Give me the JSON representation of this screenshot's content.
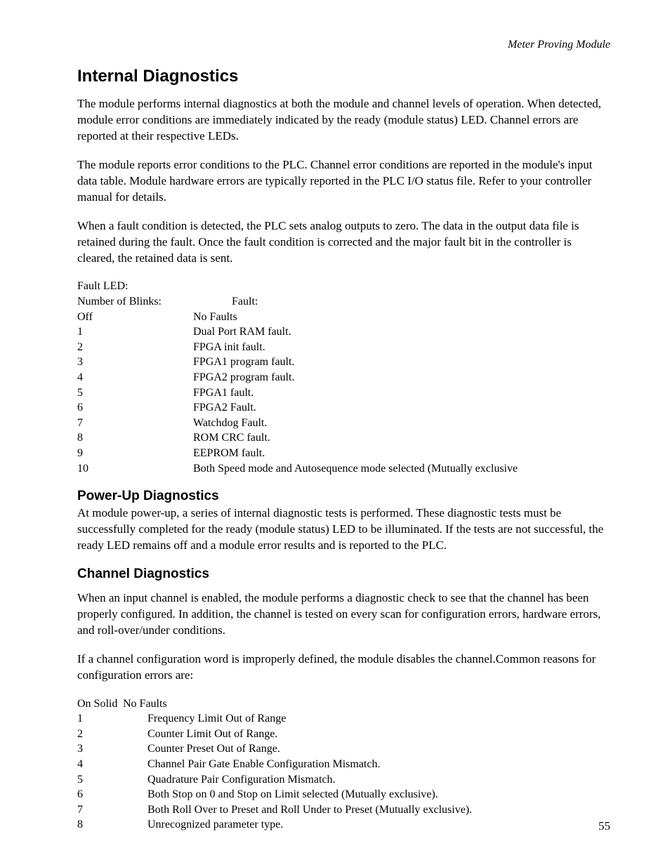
{
  "running_header": "Meter Proving Module",
  "sections": {
    "internal": {
      "title": "Internal Diagnostics",
      "para1": "The module performs internal diagnostics at both the module and channel levels of operation.  When detected, module error conditions are immediately indicated by the ready (module status) LED.  Channel errors are reported at their respective LEDs.",
      "para2": "The module reports error conditions to the PLC. Channel error conditions are reported in the module's input data table. Module hardware errors are typically reported in the PLC I/O status file.  Refer to your controller manual for details.",
      "para3": "When a fault condition is detected, the PLC sets analog outputs to zero. The data in the output data file is retained during the fault. Once the fault condition is corrected and the major fault bit in the controller is cleared, the retained data is sent.",
      "fault_table": {
        "caption": "Fault LED:",
        "header_blinks": "Number of Blinks:",
        "header_fault": "Fault:",
        "rows": [
          {
            "blinks": "Off",
            "fault": "No Faults"
          },
          {
            "blinks": "1",
            "fault": "Dual Port RAM fault."
          },
          {
            "blinks": "2",
            "fault": "FPGA init fault."
          },
          {
            "blinks": "3",
            "fault": "FPGA1 program fault."
          },
          {
            "blinks": "4",
            "fault": "FPGA2 program fault."
          },
          {
            "blinks": "5",
            "fault": "FPGA1 fault."
          },
          {
            "blinks": "6",
            "fault": "FPGA2 Fault."
          },
          {
            "blinks": "7",
            "fault": "Watchdog Fault."
          },
          {
            "blinks": "8",
            "fault": "ROM CRC fault."
          },
          {
            "blinks": "9",
            "fault": "EEPROM fault."
          },
          {
            "blinks": "10",
            "fault": "Both Speed mode and Autosequence mode selected (Mutually exclusive"
          }
        ]
      }
    },
    "powerup": {
      "title": "Power-Up Diagnostics",
      "para1": "At module power-up, a series of internal diagnostic tests is performed. These diagnostic tests must be successfully completed for the ready (module status) LED to be illuminated.  If the tests are not successful, the ready LED remains off and a module error results and is reported to the PLC."
    },
    "channel": {
      "title": "Channel Diagnostics",
      "para1": "When an input channel is enabled, the module performs a diagnostic check to see that the channel has been properly configured. In addition, the channel is tested on every scan for configuration errors, hardware errors, and roll-over/under conditions.",
      "para2": "If a channel configuration word is improperly defined, the module disables the channel.Common reasons for configuration errors are:",
      "table": {
        "header_row": {
          "c1": "On Solid",
          "c2": "No Faults"
        },
        "rows": [
          {
            "n": "1",
            "desc": "Frequency Limit Out of Range"
          },
          {
            "n": "2",
            "desc": "Counter Limit Out of Range."
          },
          {
            "n": "3",
            "desc": "Counter Preset Out of Range."
          },
          {
            "n": "4",
            "desc": "Channel Pair Gate Enable Configuration Mismatch."
          },
          {
            "n": "5",
            "desc": "Quadrature Pair Configuration Mismatch."
          },
          {
            "n": "6",
            "desc": "Both Stop on 0 and Stop on Limit selected (Mutually exclusive)."
          },
          {
            "n": "7",
            "desc": "Both Roll Over to Preset and Roll Under to Preset (Mutually exclusive)."
          },
          {
            "n": "8",
            "desc": "Unrecognized parameter type."
          }
        ]
      }
    }
  },
  "page_number": "55"
}
